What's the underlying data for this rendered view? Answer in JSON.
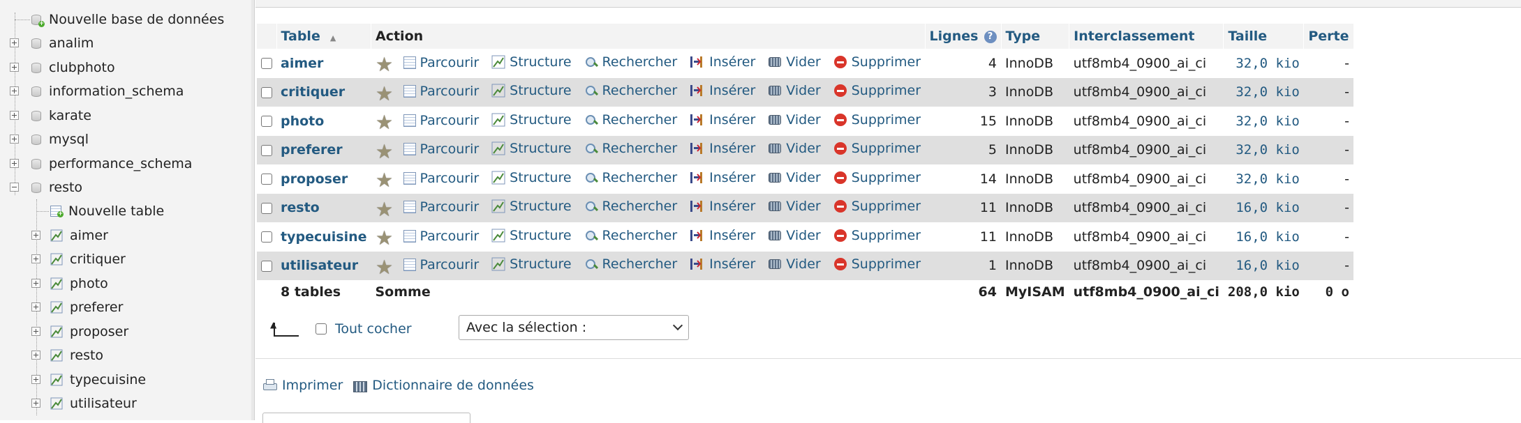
{
  "sidebar": {
    "new_database": "Nouvelle base de données",
    "databases": [
      "analim",
      "clubphoto",
      "information_schema",
      "karate",
      "mysql",
      "performance_schema",
      "resto"
    ],
    "expanded_db": {
      "name": "resto",
      "new_table": "Nouvelle table",
      "tables": [
        "aimer",
        "critiquer",
        "photo",
        "preferer",
        "proposer",
        "resto",
        "typecuisine",
        "utilisateur"
      ]
    }
  },
  "table": {
    "headers": {
      "table": "Table",
      "action": "Action",
      "rows": "Lignes",
      "type": "Type",
      "collation": "Interclassement",
      "size": "Taille",
      "overhead": "Perte"
    },
    "actions": {
      "browse": "Parcourir",
      "structure": "Structure",
      "search": "Rechercher",
      "insert": "Insérer",
      "empty": "Vider",
      "drop": "Supprimer"
    },
    "rows": [
      {
        "name": "aimer",
        "rows": "4",
        "type": "InnoDB",
        "collation": "utf8mb4_0900_ai_ci",
        "size": "32,0 kio",
        "overhead": "-"
      },
      {
        "name": "critiquer",
        "rows": "3",
        "type": "InnoDB",
        "collation": "utf8mb4_0900_ai_ci",
        "size": "32,0 kio",
        "overhead": "-"
      },
      {
        "name": "photo",
        "rows": "15",
        "type": "InnoDB",
        "collation": "utf8mb4_0900_ai_ci",
        "size": "32,0 kio",
        "overhead": "-"
      },
      {
        "name": "preferer",
        "rows": "5",
        "type": "InnoDB",
        "collation": "utf8mb4_0900_ai_ci",
        "size": "32,0 kio",
        "overhead": "-"
      },
      {
        "name": "proposer",
        "rows": "14",
        "type": "InnoDB",
        "collation": "utf8mb4_0900_ai_ci",
        "size": "32,0 kio",
        "overhead": "-"
      },
      {
        "name": "resto",
        "rows": "11",
        "type": "InnoDB",
        "collation": "utf8mb4_0900_ai_ci",
        "size": "16,0 kio",
        "overhead": "-"
      },
      {
        "name": "typecuisine",
        "rows": "11",
        "type": "InnoDB",
        "collation": "utf8mb4_0900_ai_ci",
        "size": "16,0 kio",
        "overhead": "-"
      },
      {
        "name": "utilisateur",
        "rows": "1",
        "type": "InnoDB",
        "collation": "utf8mb4_0900_ai_ci",
        "size": "16,0 kio",
        "overhead": "-"
      }
    ],
    "footer": {
      "count": "8 tables",
      "sum_label": "Somme",
      "rows": "64",
      "type": "MyISAM",
      "collation": "utf8mb4_0900_ai_ci",
      "size": "208,0 kio",
      "overhead": "0 o"
    }
  },
  "bulk": {
    "check_all": "Tout cocher",
    "with_selected": "Avec la sélection :"
  },
  "footer_links": {
    "print": "Imprimer",
    "dictionary": "Dictionnaire de données"
  },
  "colors": {
    "link": "#235a81",
    "row_even": "#dfdfdf",
    "header_bg": "#f3f3f3",
    "drop_red": "#d9352a"
  },
  "icons": {
    "favorite": "star-icon",
    "browse": "browse-icon",
    "structure": "structure-icon",
    "search": "search-icon",
    "insert": "insert-icon",
    "empty": "empty-icon",
    "drop": "drop-icon",
    "help": "help-icon",
    "print": "print-icon",
    "dictionary": "dictionary-icon"
  }
}
